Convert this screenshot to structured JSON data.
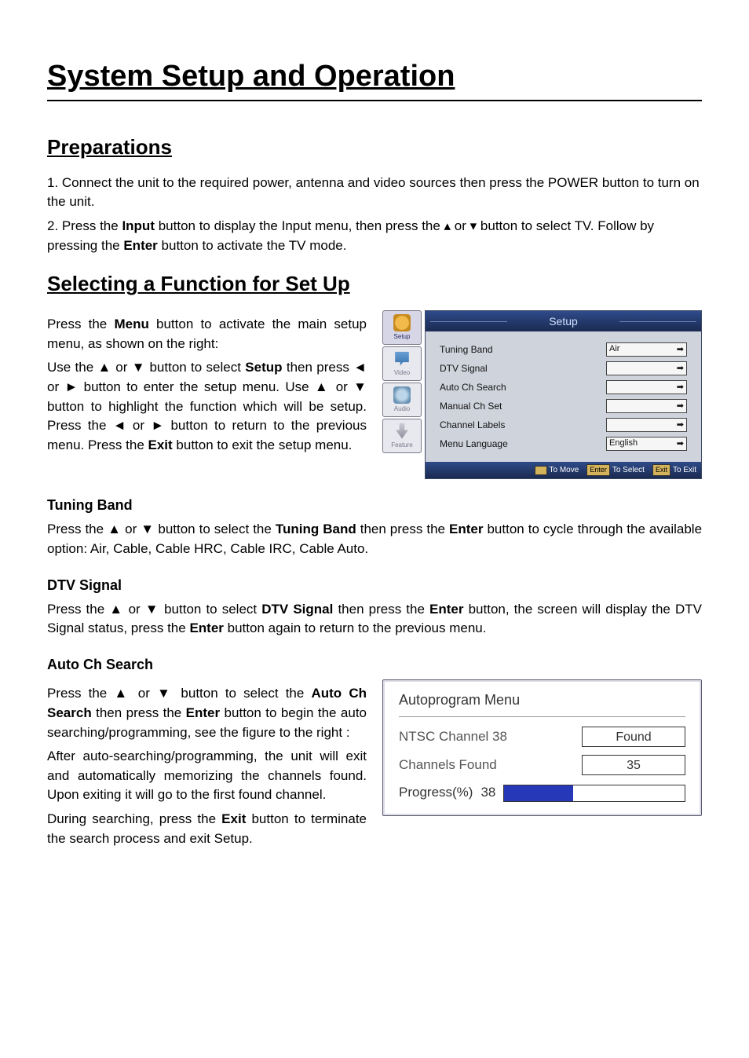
{
  "title": "System Setup and Operation",
  "sections": {
    "preparations": {
      "heading": "Preparations",
      "item1_pre": "1. Connect the unit to the required power, antenna and video sources then press the POWER button to turn on the unit.",
      "item2_a": "2. Press the ",
      "item2_input": "Input",
      "item2_b": " button to display the Input menu, then press the ▴ or ▾ button to select TV. Follow by pressing the ",
      "item2_enter": "Enter",
      "item2_c": " button to activate the TV mode."
    },
    "selecting": {
      "heading": "Selecting a Function for Set Up",
      "p1a": "Press the ",
      "menu": "Menu",
      "p1b": " button to activate the main setup menu, as shown on the right:",
      "p2a": "Use the ▲ or ▼ button to select ",
      "setup": "Setup",
      "p2b": " then press ◄ or ► button to enter the setup menu. Use ▲ or ▼ button to highlight the function which will be setup. Press the ◄ or ► button to return to the previous menu. Press the ",
      "exit": "Exit",
      "p2c": " button to exit the setup menu."
    },
    "tuning_band": {
      "heading": "Tuning Band",
      "p_a": "Press the ▲ or ▼ button to select the ",
      "bold": "Tuning Band",
      "p_b": " then press the ",
      "enter": "Enter",
      "p_c": " button to cycle through the available option: Air, Cable, Cable HRC, Cable IRC, Cable Auto."
    },
    "dtv_signal": {
      "heading": "DTV Signal",
      "p_a": "Press the ▲ or ▼ button to select ",
      "bold": "DTV Signal",
      "p_b": " then press the ",
      "enter": "Enter",
      "p_c": " button, the screen will display the DTV Signal status, press the ",
      "enter2": "Enter",
      "p_d": " button again to return to the previous menu."
    },
    "auto_ch": {
      "heading": "Auto Ch Search",
      "p1_a": "Press the ▲ or ▼ button to select the ",
      "bold1": "Auto Ch Search",
      "p1_b": " then press the ",
      "enter": "Enter",
      "p1_c": " button to begin the auto searching/programming, see the figure to the right :",
      "p2": "After auto-searching/programming, the unit will exit and automatically memorizing the channels found. Upon exiting it will go to the first found channel.",
      "p3_a": "During searching, press the ",
      "exit": "Exit",
      "p3_b": " button to terminate the search process and exit Setup."
    }
  },
  "osd": {
    "title": "Setup",
    "tabs": {
      "setup": "Setup",
      "video": "Video",
      "audio": "Audio",
      "feature": "Feature"
    },
    "rows": {
      "tuning_band": {
        "label": "Tuning Band",
        "value": "Air"
      },
      "dtv_signal": {
        "label": "DTV Signal",
        "value": ""
      },
      "auto_ch": {
        "label": "Auto Ch Search",
        "value": ""
      },
      "manual_ch": {
        "label": "Manual Ch Set",
        "value": ""
      },
      "ch_labels": {
        "label": "Channel Labels",
        "value": ""
      },
      "menu_lang": {
        "label": "Menu Language",
        "value": "English"
      }
    },
    "footer": {
      "move": "To Move",
      "enter_btn": "Enter",
      "select": "To Select",
      "exit_btn": "Exit",
      "exit": "To Exit"
    }
  },
  "autoprogram": {
    "title": "Autoprogram Menu",
    "row1_label": "NTSC Channel 38",
    "row1_value": "Found",
    "row2_label": "Channels Found",
    "row2_value": "35",
    "progress_label": "Progress(%)",
    "progress_value": "38",
    "progress_pct": 38
  }
}
